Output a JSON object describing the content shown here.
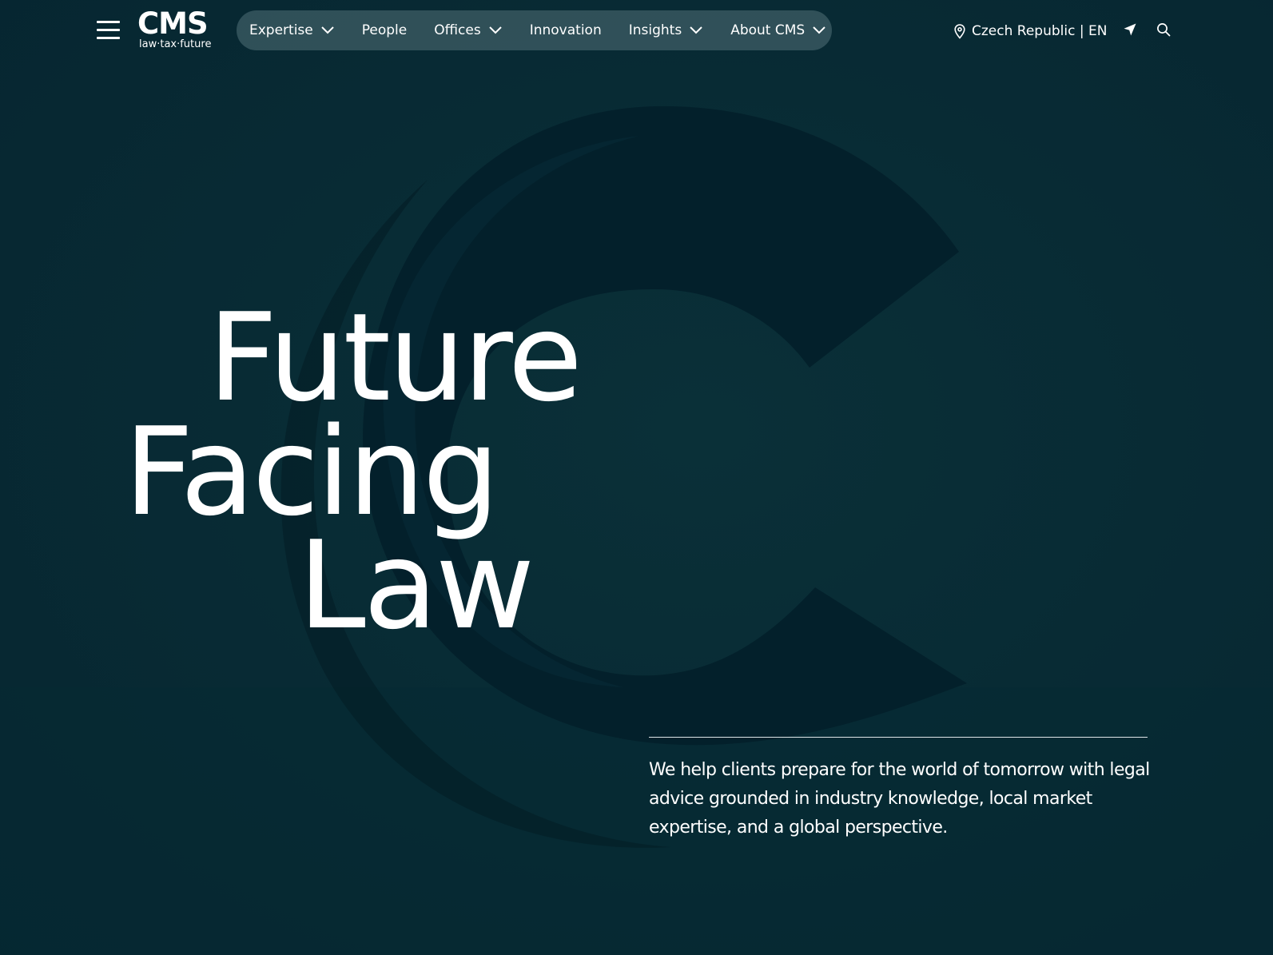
{
  "colors": {
    "background": "#06262e",
    "nav_pill": "#4a6a70",
    "text": "#ffffff"
  },
  "header": {
    "menu_icon": "hamburger-menu-icon",
    "logo": {
      "mark": "CMS",
      "tagline": "law·tax·future"
    },
    "nav": [
      {
        "label": "Expertise",
        "has_dropdown": true
      },
      {
        "label": "People",
        "has_dropdown": false
      },
      {
        "label": "Offices",
        "has_dropdown": true
      },
      {
        "label": "Innovation",
        "has_dropdown": false
      },
      {
        "label": "Insights",
        "has_dropdown": true
      },
      {
        "label": "About CMS",
        "has_dropdown": true
      }
    ],
    "country_selector": {
      "icon": "location-pin-icon",
      "label": "Czech Republic | EN"
    },
    "locate_icon": "navigation-arrow-icon",
    "search_icon": "search-icon"
  },
  "hero": {
    "headline": [
      "Future",
      "Facing",
      "Law"
    ],
    "intro": "We help clients prepare for the world of tomorrow with legal advice grounded in industry knowledge, local market expertise, and a global perspective."
  }
}
